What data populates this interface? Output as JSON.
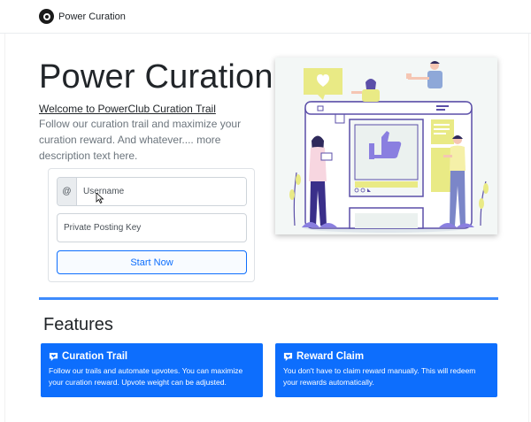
{
  "header": {
    "brand": "Power Curation"
  },
  "hero": {
    "title": "Power Curation",
    "welcome_link": "Welcome to PowerClub Curation Trail",
    "lead": "Follow our curation trail and maximize your curation reward. And whatever.... more description text here."
  },
  "login": {
    "username_addon": "@",
    "username_placeholder": "Username",
    "key_placeholder": "Private Posting Key",
    "start_button": "Start Now"
  },
  "features": {
    "title": "Features",
    "cards": [
      {
        "title": "Curation Trail",
        "text": "Follow our trails and automate upvotes. You can maximize your curation reward. Upvote weight can be adjusted.",
        "icon": "heart-comment-icon"
      },
      {
        "title": "Reward Claim",
        "text": "You don't have to claim reward manually. This will redeem your rewards automatically.",
        "icon": "heart-comment-icon"
      }
    ]
  },
  "colors": {
    "primary": "#0d6efd",
    "divider": "#3d8bfd",
    "illustration_yellow": "#e9ea85",
    "illustration_purple": "#5b4fa8"
  }
}
